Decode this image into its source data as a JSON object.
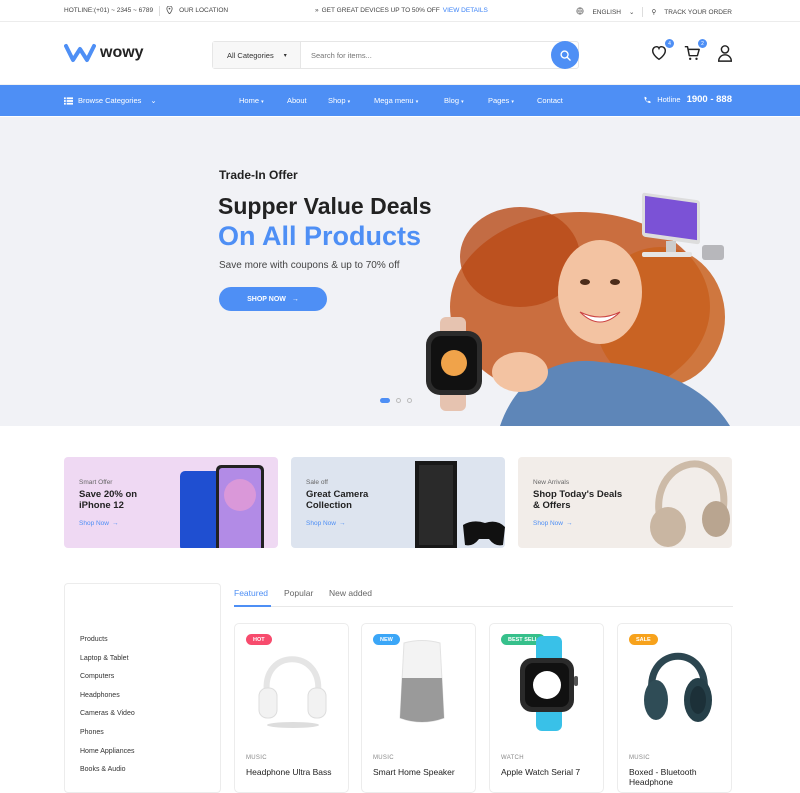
{
  "topbar": {
    "hotline": "HOTLINE:(+01) ~ 2345 ~ 6789",
    "location": "OUR LOCATION",
    "promo": "GET GREAT DEVICES UP TO 50% OFF",
    "promo_link": "VIEW DETAILS",
    "language": "ENGLISH",
    "track": "TRACK YOUR ORDER"
  },
  "header": {
    "logo": "wowy",
    "search_category": "All Categories",
    "search_placeholder": "Search for items...",
    "wishlist_count": "4",
    "cart_count": "2"
  },
  "nav": {
    "browse": "Browse Categories",
    "items": [
      "Home",
      "About",
      "Shop",
      "Mega menu",
      "Blog",
      "Pages",
      "Contact"
    ],
    "hotline_label": "Hotline",
    "hotline_number": "1900 - 888"
  },
  "hero": {
    "kicker": "Trade-In Offer",
    "title1": "Supper Value Deals",
    "title2": "On All Products",
    "subtitle": "Save more with coupons & up to 70% off",
    "cta": "SHOP NOW"
  },
  "banners": [
    {
      "small": "Smart Offer",
      "title": "Save 20% on iPhone 12",
      "shop": "Shop Now"
    },
    {
      "small": "Sale off",
      "title": "Great Camera Collection",
      "shop": "Shop Now"
    },
    {
      "small": "New Arrivals",
      "title": "Shop Today's Deals & Offers",
      "shop": "Shop Now"
    }
  ],
  "sidebar": {
    "items": [
      "Products",
      "Laptop & Tablet",
      "Computers",
      "Headphones",
      "Cameras & Video",
      "Phones",
      "Home Appliances",
      "Books & Audio"
    ]
  },
  "tabs": [
    "Featured",
    "Popular",
    "New added"
  ],
  "products": [
    {
      "tag": "HOT",
      "category": "MUSIC",
      "name": "Headphone Ultra Bass"
    },
    {
      "tag": "NEW",
      "category": "MUSIC",
      "name": "Smart Home Speaker"
    },
    {
      "tag": "BEST SELL",
      "category": "WATCH",
      "name": "Apple Watch Serial 7"
    },
    {
      "tag": "SALE",
      "category": "MUSIC",
      "name": "Boxed - Bluetooth Headphone"
    }
  ],
  "colors": {
    "accent": "#4e8ff5",
    "hot": "#f74b6d",
    "new": "#3ba6f7",
    "best": "#36c08b",
    "sale": "#f7a21c"
  }
}
